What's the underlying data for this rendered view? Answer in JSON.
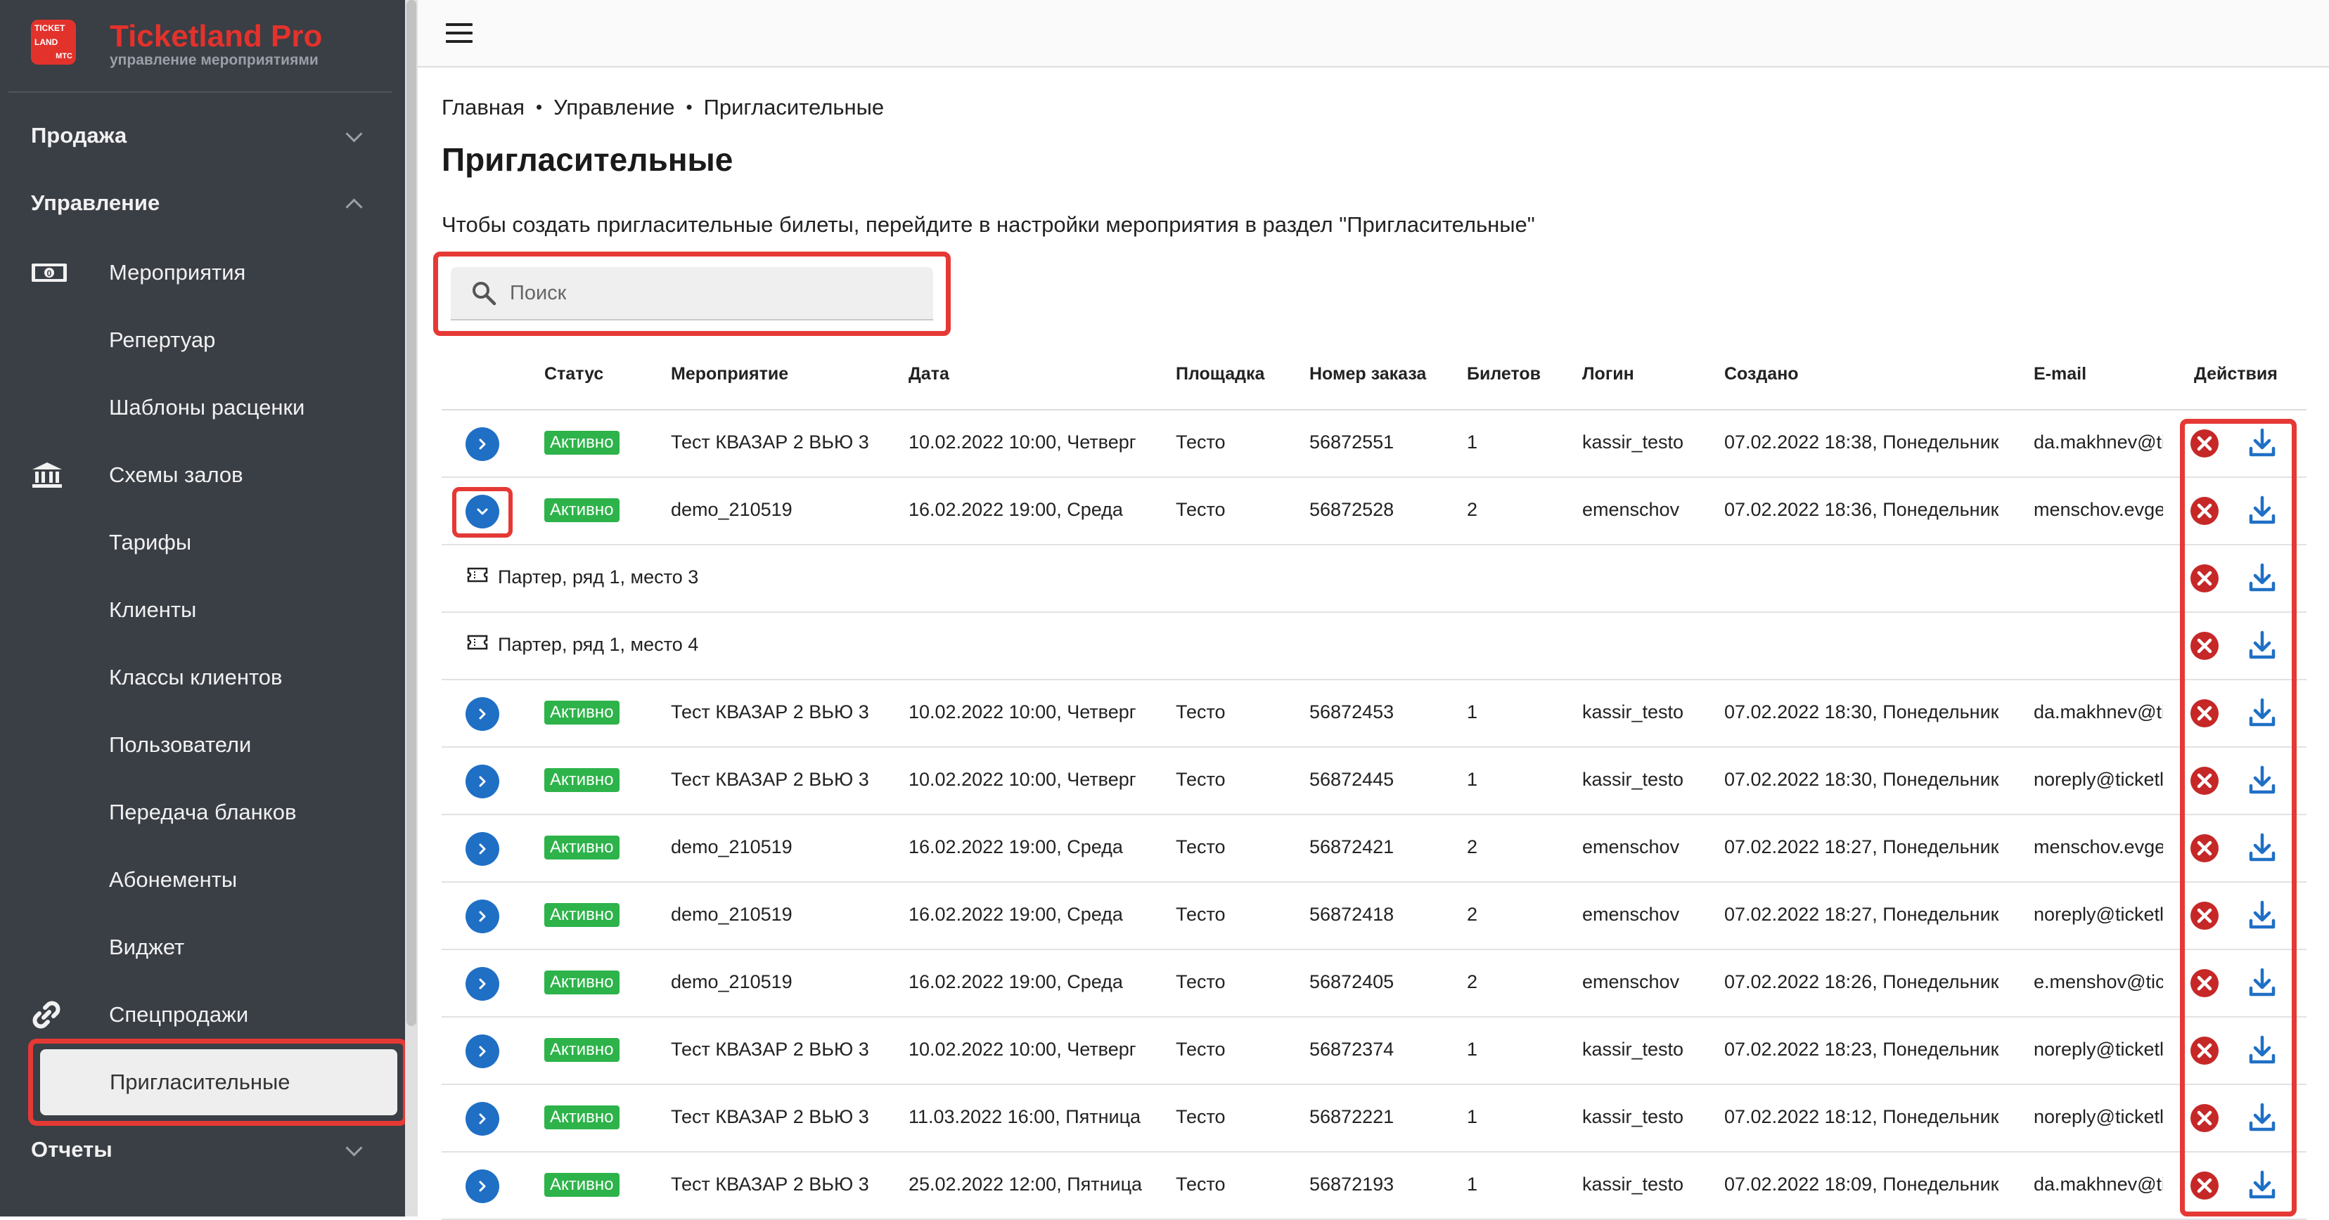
{
  "brand": {
    "logo_lines": [
      "TICKET",
      "LAND",
      "МТС"
    ],
    "title": "Ticketland Pro",
    "subtitle": "управление мероприятиями"
  },
  "sidebar": {
    "sections": [
      {
        "label": "Продажа",
        "state": "collapsed"
      },
      {
        "label": "Управление",
        "state": "expanded"
      },
      {
        "label": "Отчеты",
        "state": "collapsed"
      }
    ],
    "items": [
      {
        "label": "Мероприятия",
        "icon": "money-icon"
      },
      {
        "label": "Репертуар",
        "icon": ""
      },
      {
        "label": "Шаблоны расценки",
        "icon": ""
      },
      {
        "label": "Схемы залов",
        "icon": "bank-icon"
      },
      {
        "label": "Тарифы",
        "icon": ""
      },
      {
        "label": "Клиенты",
        "icon": ""
      },
      {
        "label": "Классы клиентов",
        "icon": ""
      },
      {
        "label": "Пользователи",
        "icon": ""
      },
      {
        "label": "Передача бланков",
        "icon": ""
      },
      {
        "label": "Абонементы",
        "icon": ""
      },
      {
        "label": "Виджет",
        "icon": ""
      },
      {
        "label": "Спецпродажи",
        "icon": "link-icon"
      },
      {
        "label": "Пригласительные",
        "icon": "",
        "active": true
      }
    ]
  },
  "breadcrumb": [
    "Главная",
    "Управление",
    "Пригласительные"
  ],
  "breadcrumb_separator": "•",
  "page_title": "Пригласительные",
  "hint": "Чтобы создать пригласительные билеты, перейдите в настройки мероприятия в раздел \"Пригласительные\"",
  "search": {
    "placeholder": "Поиск",
    "value": ""
  },
  "table": {
    "headers": [
      "Статус",
      "Мероприятие",
      "Дата",
      "Площадка",
      "Номер заказа",
      "Билетов",
      "Логин",
      "Создано",
      "E-mail",
      "Действия"
    ],
    "rows": [
      {
        "status": "Активно",
        "event": "Тест КВАЗАР 2 ВЬЮ 3",
        "date": "10.02.2022 10:00, Четверг",
        "venue": "Тесто",
        "order": "56872551",
        "tickets": "1",
        "login": "kassir_testo",
        "created": "07.02.2022 18:38, Понедельник",
        "email": "da.makhnev@ti"
      },
      {
        "status": "Активно",
        "event": "demo_210519",
        "date": "16.02.2022 19:00, Среда",
        "venue": "Тесто",
        "order": "56872528",
        "tickets": "2",
        "login": "emenschov",
        "created": "07.02.2022 18:36, Понедельник",
        "email": "menschov.evge"
      },
      {
        "status": "Активно",
        "event": "Тест КВАЗАР 2 ВЬЮ 3",
        "date": "10.02.2022 10:00, Четверг",
        "venue": "Тесто",
        "order": "56872453",
        "tickets": "1",
        "login": "kassir_testo",
        "created": "07.02.2022 18:30, Понедельник",
        "email": "da.makhnev@ti"
      },
      {
        "status": "Активно",
        "event": "Тест КВАЗАР 2 ВЬЮ 3",
        "date": "10.02.2022 10:00, Четверг",
        "venue": "Тесто",
        "order": "56872445",
        "tickets": "1",
        "login": "kassir_testo",
        "created": "07.02.2022 18:30, Понедельник",
        "email": "noreply@ticketl"
      },
      {
        "status": "Активно",
        "event": "demo_210519",
        "date": "16.02.2022 19:00, Среда",
        "venue": "Тесто",
        "order": "56872421",
        "tickets": "2",
        "login": "emenschov",
        "created": "07.02.2022 18:27, Понедельник",
        "email": "menschov.evge"
      },
      {
        "status": "Активно",
        "event": "demo_210519",
        "date": "16.02.2022 19:00, Среда",
        "venue": "Тесто",
        "order": "56872418",
        "tickets": "2",
        "login": "emenschov",
        "created": "07.02.2022 18:27, Понедельник",
        "email": "noreply@ticketl"
      },
      {
        "status": "Активно",
        "event": "demo_210519",
        "date": "16.02.2022 19:00, Среда",
        "venue": "Тесто",
        "order": "56872405",
        "tickets": "2",
        "login": "emenschov",
        "created": "07.02.2022 18:26, Понедельник",
        "email": "e.menshov@ticl"
      },
      {
        "status": "Активно",
        "event": "Тест КВАЗАР 2 ВЬЮ 3",
        "date": "10.02.2022 10:00, Четверг",
        "venue": "Тесто",
        "order": "56872374",
        "tickets": "1",
        "login": "kassir_testo",
        "created": "07.02.2022 18:23, Понедельник",
        "email": "noreply@ticketl"
      },
      {
        "status": "Активно",
        "event": "Тест КВАЗАР 2 ВЬЮ 3",
        "date": "11.03.2022 16:00, Пятница",
        "venue": "Тесто",
        "order": "56872221",
        "tickets": "1",
        "login": "kassir_testo",
        "created": "07.02.2022 18:12, Понедельник",
        "email": "noreply@ticketl"
      },
      {
        "status": "Активно",
        "event": "Тест КВАЗАР 2 ВЬЮ 3",
        "date": "25.02.2022 12:00, Пятница",
        "venue": "Тесто",
        "order": "56872193",
        "tickets": "1",
        "login": "kassir_testo",
        "created": "07.02.2022 18:09, Понедельник",
        "email": "da.makhnev@ti"
      }
    ],
    "expanded_tickets": [
      "Партер, ряд 1, место 3",
      "Партер, ряд 1, место 4"
    ]
  },
  "colors": {
    "sidebar_bg": "#3a3e45",
    "brand_red": "#e3322c",
    "highlight_red": "#e53935",
    "status_green": "#2db34a",
    "action_blue": "#1f6fc5",
    "delete_red": "#c62828"
  }
}
